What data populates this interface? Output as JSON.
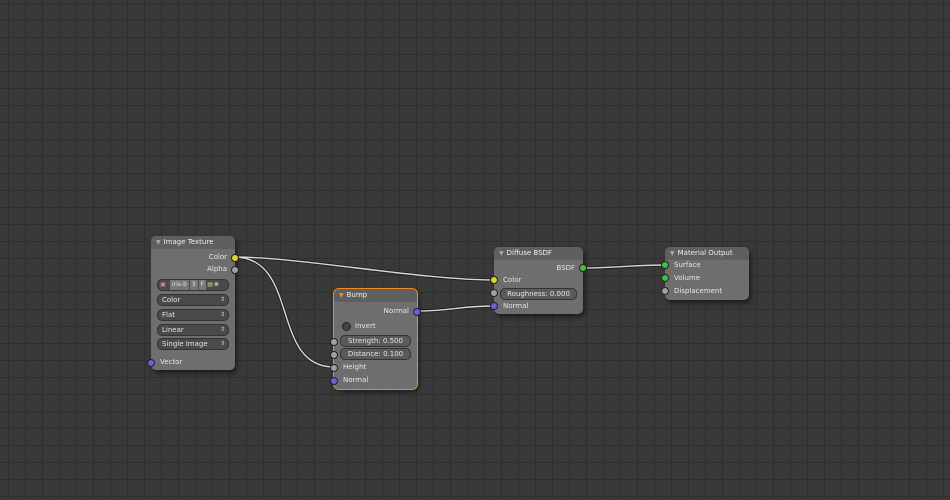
{
  "nodes": {
    "image_texture": {
      "title": "Image Texture",
      "out_color": "Color",
      "out_alpha": "Alpha",
      "image_name": "iris-b",
      "users": "3",
      "fake": "F",
      "color_space": "Color",
      "projection": "Flat",
      "interpolation": "Linear",
      "source": "Single Image",
      "in_vector": "Vector"
    },
    "bump": {
      "title": "Bump",
      "out_normal": "Normal",
      "invert": "Invert",
      "strength_label": "Strength:",
      "strength": "0.500",
      "distance_label": "Distance:",
      "distance": "0.100",
      "in_height": "Height",
      "in_normal": "Normal"
    },
    "diffuse": {
      "title": "Diffuse BSDF",
      "out_bsdf": "BSDF",
      "in_color": "Color",
      "roughness_label": "Roughness:",
      "roughness": "0.000",
      "in_normal": "Normal"
    },
    "output": {
      "title": "Material Output",
      "in_surface": "Surface",
      "in_volume": "Volume",
      "in_displacement": "Displacement"
    }
  }
}
